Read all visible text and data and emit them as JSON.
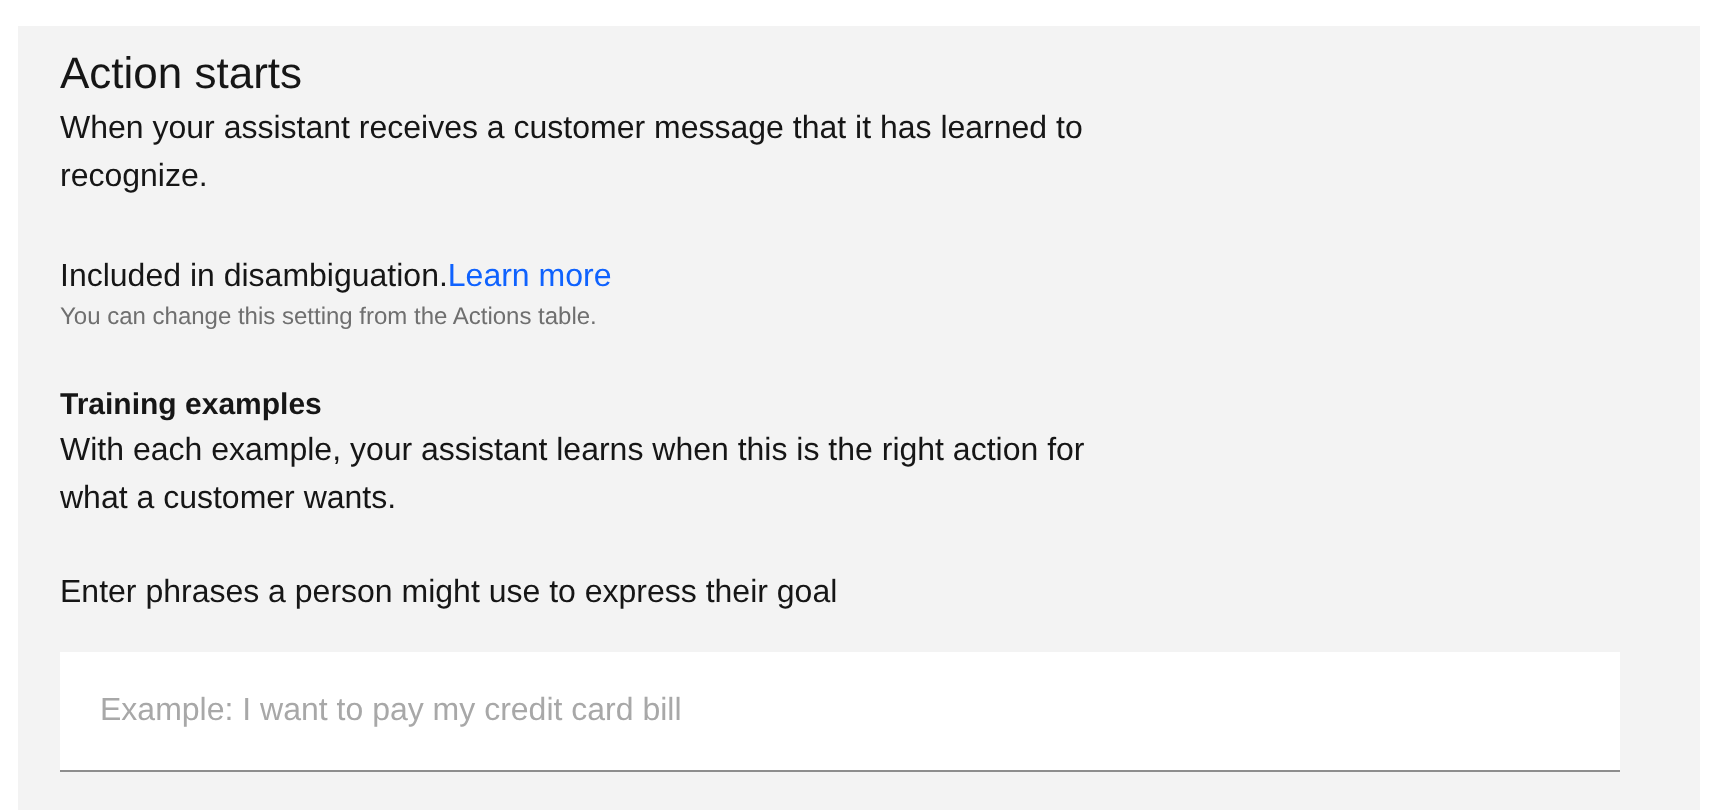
{
  "section": {
    "title": "Action starts",
    "description": "When your assistant receives a customer message that it has learned to recognize.",
    "disambiguation": {
      "text": "Included in disambiguation.",
      "link": "Learn more",
      "hint": "You can change this setting from the Actions table."
    },
    "training": {
      "heading": "Training examples",
      "description": "With each example, your assistant learns when this is the right action for what a customer wants.",
      "prompt": "Enter phrases a person might use to express their goal",
      "input": {
        "placeholder": "Example: I want to pay my credit card bill"
      }
    }
  }
}
